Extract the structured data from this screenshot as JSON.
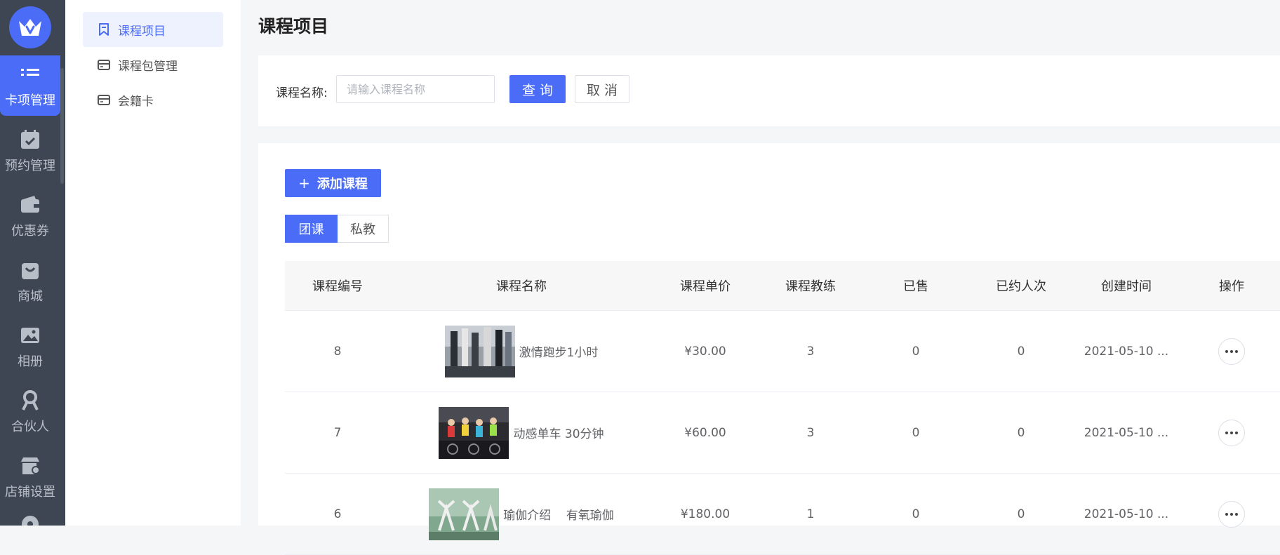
{
  "rail": {
    "items": [
      {
        "label": "卡项管理",
        "icon": "list-icon",
        "active": true
      },
      {
        "label": "预约管理",
        "icon": "calendar-check-icon"
      },
      {
        "label": "优惠券",
        "icon": "wallet-icon"
      },
      {
        "label": "商城",
        "icon": "shopping-bag-icon"
      },
      {
        "label": "相册",
        "icon": "photo-album-icon"
      },
      {
        "label": "合伙人",
        "icon": "partner-icon"
      },
      {
        "label": "店铺设置",
        "icon": "store-settings-icon"
      }
    ]
  },
  "subnav": {
    "items": [
      {
        "label": "课程项目",
        "icon": "bookmark-icon",
        "active": true
      },
      {
        "label": "课程包管理",
        "icon": "card-icon"
      },
      {
        "label": "会籍卡",
        "icon": "card-icon"
      }
    ]
  },
  "page": {
    "title": "课程项目"
  },
  "filter": {
    "label": "课程名称:",
    "placeholder": "请输入课程名称",
    "search_label": "查 询",
    "cancel_label": "取 消"
  },
  "list": {
    "add_label": "添加课程",
    "tabs": [
      {
        "label": "团课",
        "active": true
      },
      {
        "label": "私教"
      }
    ],
    "columns": [
      "课程编号",
      "课程名称",
      "课程单价",
      "课程教练",
      "已售",
      "已约人次",
      "创建时间",
      "操作"
    ],
    "rows": [
      {
        "id": "8",
        "name": "激情跑步1小时",
        "price": "¥30.00",
        "coach": "3",
        "sold": "0",
        "booked": "0",
        "created": "2021-05-10 ...",
        "thumb": "treadmill"
      },
      {
        "id": "7",
        "name": "动感单车 30分钟",
        "price": "¥60.00",
        "coach": "3",
        "sold": "0",
        "booked": "0",
        "created": "2021-05-10 ...",
        "thumb": "spinning"
      },
      {
        "id": "6",
        "name": "瑜伽介绍    有氧瑜伽",
        "price": "¥180.00",
        "coach": "1",
        "sold": "0",
        "booked": "0",
        "created": "2021-05-10 ...",
        "thumb": "yoga"
      }
    ]
  },
  "colors": {
    "primary": "#4a6cf7",
    "rail_bg": "#3e4653"
  }
}
